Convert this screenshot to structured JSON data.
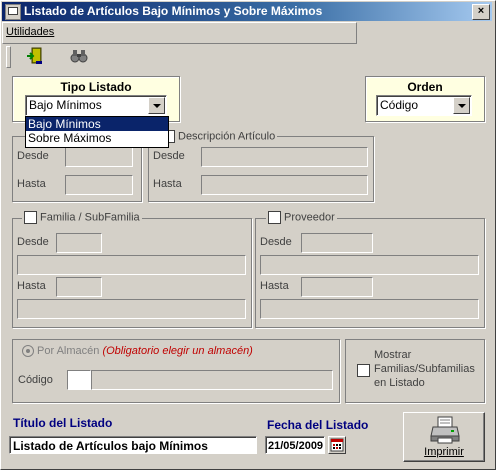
{
  "window": {
    "title": "Listado de Artículos Bajo Mínimos y Sobre Máximos",
    "close": "×"
  },
  "menu": {
    "utilidades": "Utilidades"
  },
  "tipo_listado": {
    "label": "Tipo Listado",
    "value": "Bajo Mínimos",
    "options": [
      "Bajo Mínimos",
      "Sobre Máximos"
    ]
  },
  "orden": {
    "label": "Orden",
    "value": "Código"
  },
  "codigo_group": {
    "desde": "Desde",
    "hasta": "Hasta"
  },
  "descripcion": {
    "label": "Descripción Artículo",
    "desde": "Desde",
    "hasta": "Hasta"
  },
  "familia": {
    "label": "Familia / SubFamilia",
    "desde": "Desde",
    "hasta": "Hasta"
  },
  "proveedor": {
    "label": "Proveedor",
    "desde": "Desde",
    "hasta": "Hasta"
  },
  "almacen": {
    "label": "Por Almacén",
    "required_note": "(Obligatorio elegir un almacén)",
    "codigo": "Código"
  },
  "mostrar": {
    "label": "Mostrar Familias/Subfamilias en Listado"
  },
  "titulo": {
    "label": "Título del Listado",
    "value": "Listado de Artículos bajo Mínimos"
  },
  "fecha": {
    "label": "Fecha del Listado",
    "value": "21/05/2009"
  },
  "imprimir": {
    "label": "Imprimir"
  }
}
